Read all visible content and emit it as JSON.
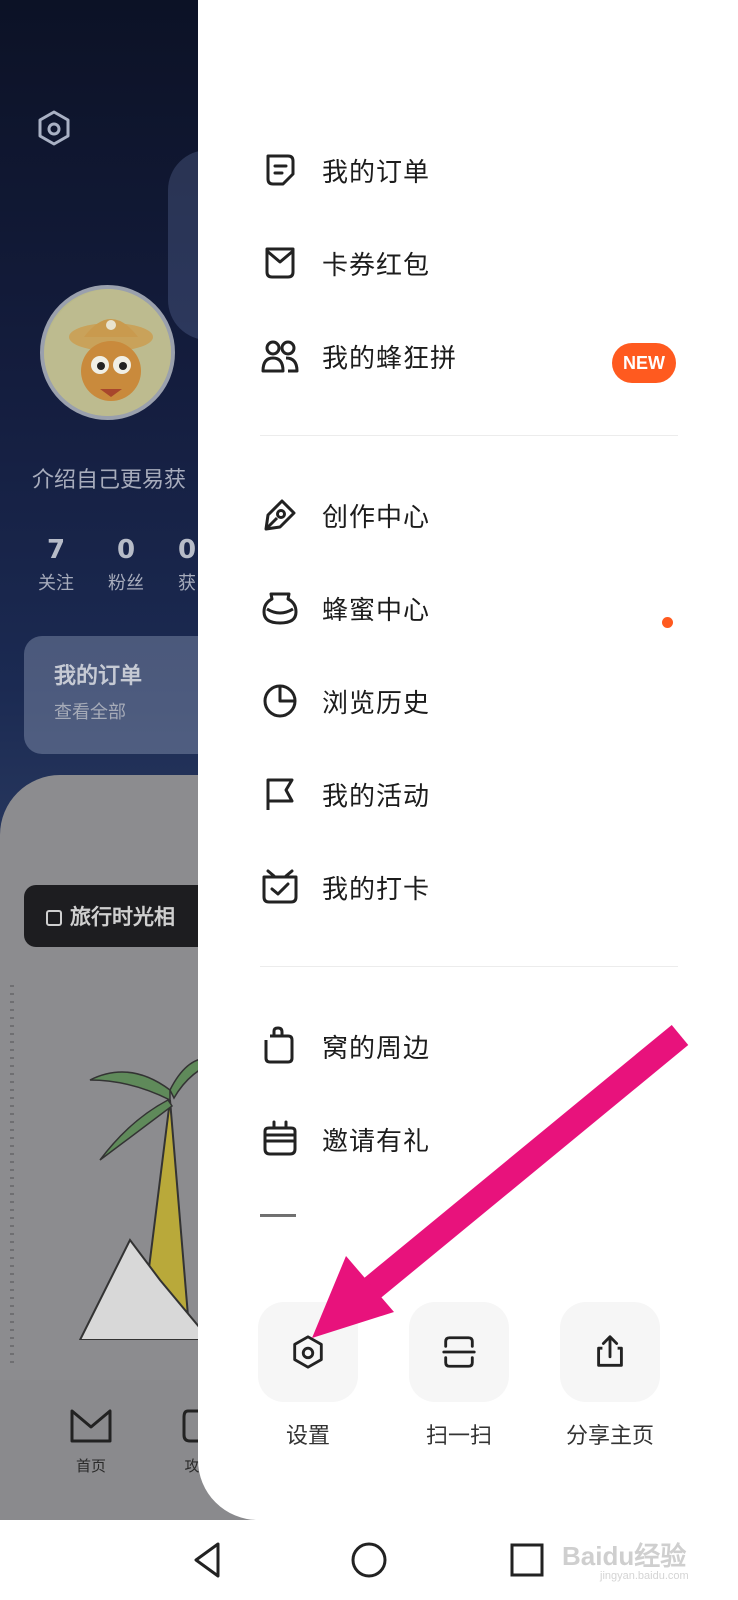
{
  "background": {
    "bio": "介绍自己更易获",
    "stats": [
      {
        "num": "7",
        "label": "关注"
      },
      {
        "num": "0",
        "label": "粉丝"
      },
      {
        "num": "0",
        "label": "获"
      }
    ],
    "order_card": {
      "title": "我的订单",
      "subtitle": "查看全部"
    },
    "album_label": "旅行时光相",
    "tabs": [
      {
        "label": "首页",
        "icon": "home-icon"
      },
      {
        "label": "攻",
        "icon": "guide-icon"
      }
    ]
  },
  "drawer": {
    "menu_groups": [
      [
        {
          "label": "我的订单",
          "icon": "order-icon"
        },
        {
          "label": "卡券红包",
          "icon": "coupon-icon"
        },
        {
          "label": "我的蜂狂拼",
          "icon": "group-buy-icon",
          "badge": "NEW"
        }
      ],
      [
        {
          "label": "创作中心",
          "icon": "creation-icon"
        },
        {
          "label": "蜂蜜中心",
          "icon": "honey-jar-icon",
          "dot": true
        },
        {
          "label": "浏览历史",
          "icon": "history-icon"
        },
        {
          "label": "我的活动",
          "icon": "flag-icon"
        },
        {
          "label": "我的打卡",
          "icon": "checkin-icon"
        }
      ],
      [
        {
          "label": "窝的周边",
          "icon": "merch-icon"
        },
        {
          "label": "邀请有礼",
          "icon": "gift-icon"
        }
      ]
    ],
    "quick_actions": [
      {
        "label": "设置",
        "icon": "settings-icon"
      },
      {
        "label": "扫一扫",
        "icon": "scan-icon"
      },
      {
        "label": "分享主页",
        "icon": "share-icon"
      }
    ],
    "accent_color": "#ff5a1f"
  },
  "annotation": {
    "color": "#e8127c",
    "icon": "pointer-arrow"
  },
  "system_nav": {
    "buttons": [
      "back-icon",
      "home-circle-icon",
      "recents-icon"
    ],
    "watermark": "Baidu经验",
    "watermark_sub": "jingyan.baidu.com"
  }
}
